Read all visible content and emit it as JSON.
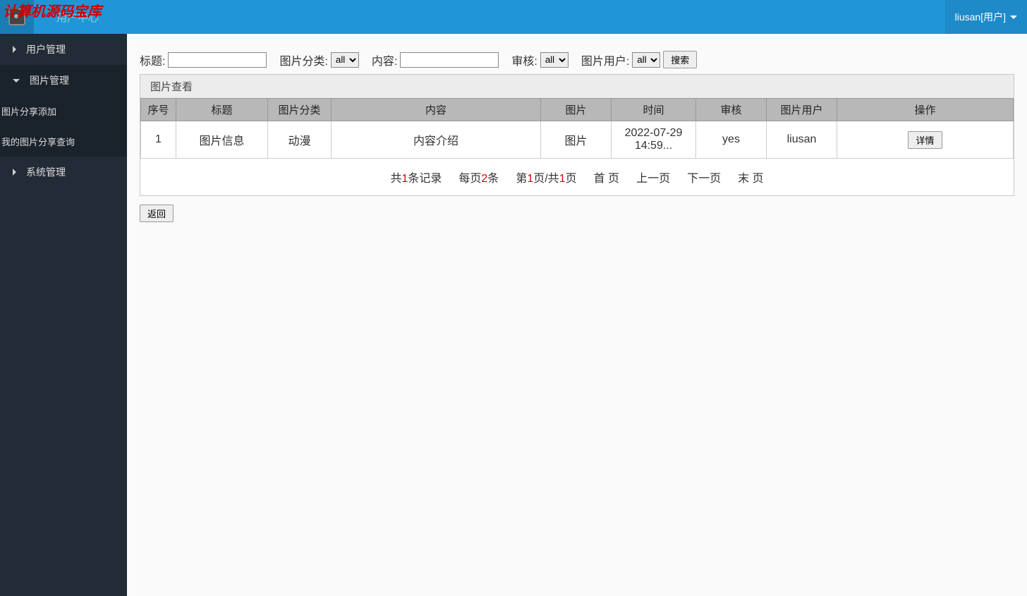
{
  "site_title": "计算机源码宝库",
  "topbar_center": "用户中心",
  "user_label": "liusan[用户]",
  "sidebar": {
    "items": [
      {
        "label": "用户管理",
        "type": "item",
        "expanded": false
      },
      {
        "label": "图片管理",
        "type": "item",
        "expanded": true,
        "subs": [
          {
            "label": "图片分享添加"
          },
          {
            "label": "我的图片分享查询"
          }
        ]
      },
      {
        "label": "系统管理",
        "type": "item",
        "expanded": false
      }
    ]
  },
  "filters": {
    "title_label": "标题:",
    "title_value": "",
    "category_label": "图片分类:",
    "category_value": "all",
    "content_label": "内容:",
    "content_value": "",
    "audit_label": "审核:",
    "audit_value": "all",
    "user_label": "图片用户:",
    "user_value": "all",
    "search_btn": "搜索"
  },
  "panel": {
    "title": "图片查看",
    "headers": [
      "序号",
      "标题",
      "图片分类",
      "内容",
      "图片",
      "时间",
      "审核",
      "图片用户",
      "操作"
    ],
    "row": {
      "seq": "1",
      "title": "图片信息",
      "category": "动漫",
      "content": "内容介绍",
      "image": "图片",
      "time": "2022-07-29 14:59...",
      "audit": "yes",
      "user": "liusan",
      "action_btn": "详情"
    }
  },
  "pager": {
    "total_pre": "共",
    "total_num": "1",
    "total_suf": "条记录",
    "per_pre": "每页",
    "per_num": "2",
    "per_suf": "条",
    "page_pre": "第",
    "page_cur": "1",
    "page_mid": "页/共",
    "page_total": "1",
    "page_suf": "页",
    "first": "首 页",
    "prev": "上一页",
    "next": "下一页",
    "last": "末 页"
  },
  "back_btn": "返回"
}
